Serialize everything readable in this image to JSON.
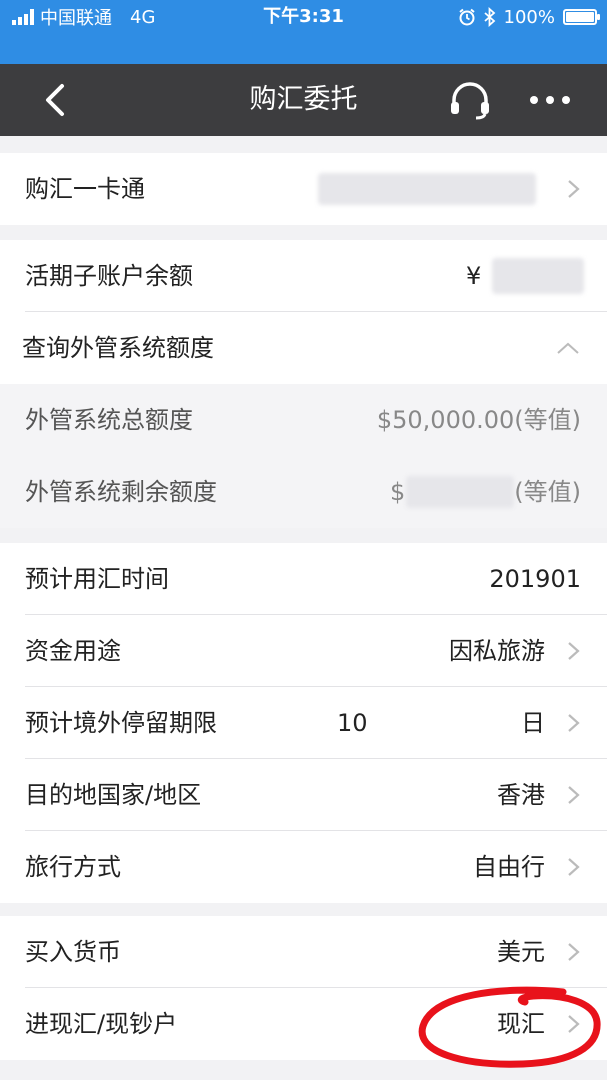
{
  "status_bar": {
    "carrier": "中国联通",
    "network": "4G",
    "time": "下午3:31",
    "battery_text": "100%",
    "battery_level": 1.0,
    "icons": [
      "signal-icon",
      "alarm-icon",
      "bluetooth-icon",
      "battery-icon"
    ]
  },
  "nav": {
    "title": "购汇委托",
    "icons": [
      "back-chevron-icon",
      "headset-icon",
      "more-dots-icon"
    ]
  },
  "rows": {
    "card": {
      "label": "购汇一卡通"
    },
    "balance": {
      "label": "活期子账户余额",
      "currency_symbol": "¥"
    },
    "quota_query": {
      "label": "查询外管系统额度"
    },
    "total_quota": {
      "label": "外管系统总额度",
      "value": "$50,000.00(等值)"
    },
    "remaining_quota": {
      "label": "外管系统剩余额度",
      "prefix": "$",
      "suffix": "(等值)"
    },
    "usage_time": {
      "label": "预计用汇时间",
      "value": "201901"
    },
    "purpose": {
      "label": "资金用途",
      "value": "因私旅游"
    },
    "stay": {
      "label": "预计境外停留期限",
      "value": "10",
      "unit": "日"
    },
    "destination": {
      "label": "目的地国家/地区",
      "value": "香港"
    },
    "travel_mode": {
      "label": "旅行方式",
      "value": "自由行"
    },
    "buy_currency": {
      "label": "买入货币",
      "value": "美元"
    },
    "cash_type": {
      "label": "进现汇/现钞户",
      "value": "现汇"
    }
  },
  "colors": {
    "status_bar": "#2f8de4",
    "nav_bar": "#3d3d3f",
    "annotation": "#e8121b"
  }
}
